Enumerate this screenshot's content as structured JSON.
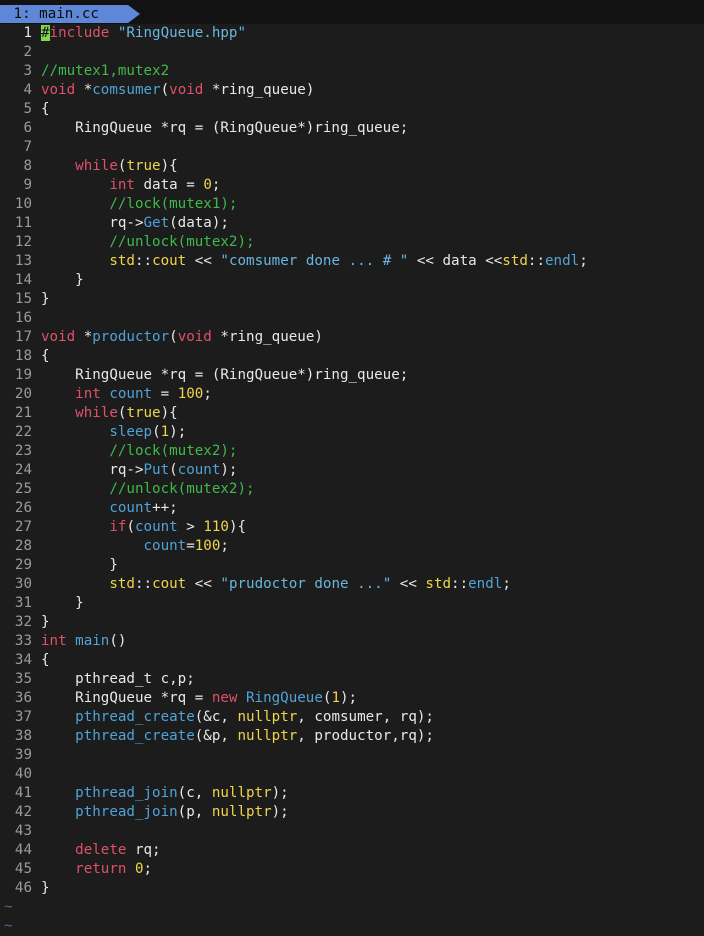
{
  "tabline": {
    "tab_label": " 1: main.cc"
  },
  "editor": {
    "lines": [
      {
        "n": "1",
        "segs": [
          [
            "cursor",
            "#"
          ],
          [
            "kw",
            "include"
          ],
          [
            "tx",
            " "
          ],
          [
            "st",
            "\"RingQueue.hpp\""
          ]
        ]
      },
      {
        "n": "2",
        "segs": []
      },
      {
        "n": "3",
        "segs": [
          [
            "cm",
            "//mutex1,mutex2"
          ]
        ]
      },
      {
        "n": "4",
        "segs": [
          [
            "kw",
            "void"
          ],
          [
            "tx",
            " *"
          ],
          [
            "fn",
            "comsumer"
          ],
          [
            "tx",
            "("
          ],
          [
            "kw",
            "void"
          ],
          [
            "tx",
            " *ring_queue)"
          ]
        ]
      },
      {
        "n": "5",
        "segs": [
          [
            "tx",
            "{"
          ]
        ]
      },
      {
        "n": "6",
        "segs": [
          [
            "tx",
            "    RingQueue *rq = (RingQueue*)ring_queue;"
          ]
        ]
      },
      {
        "n": "7",
        "segs": []
      },
      {
        "n": "8",
        "segs": [
          [
            "tx",
            "    "
          ],
          [
            "kw",
            "while"
          ],
          [
            "tx",
            "("
          ],
          [
            "bo",
            "true"
          ],
          [
            "tx",
            "){"
          ]
        ]
      },
      {
        "n": "9",
        "segs": [
          [
            "tx",
            "        "
          ],
          [
            "kw",
            "int"
          ],
          [
            "tx",
            " data = "
          ],
          [
            "nm",
            "0"
          ],
          [
            "tx",
            ";"
          ]
        ]
      },
      {
        "n": "10",
        "segs": [
          [
            "tx",
            "        "
          ],
          [
            "cm",
            "//lock(mutex1);"
          ]
        ]
      },
      {
        "n": "11",
        "segs": [
          [
            "tx",
            "        rq->"
          ],
          [
            "fn",
            "Get"
          ],
          [
            "tx",
            "(data);"
          ]
        ]
      },
      {
        "n": "12",
        "segs": [
          [
            "tx",
            "        "
          ],
          [
            "cm",
            "//unlock(mutex2);"
          ]
        ]
      },
      {
        "n": "13",
        "segs": [
          [
            "tx",
            "        "
          ],
          [
            "bo",
            "std"
          ],
          [
            "tx",
            "::"
          ],
          [
            "bo",
            "cout"
          ],
          [
            "tx",
            " << "
          ],
          [
            "st",
            "\"comsumer done ... # \""
          ],
          [
            "tx",
            " << data <<"
          ],
          [
            "bo",
            "std"
          ],
          [
            "tx",
            "::"
          ],
          [
            "fn",
            "endl"
          ],
          [
            "tx",
            ";"
          ]
        ]
      },
      {
        "n": "14",
        "segs": [
          [
            "tx",
            "    }"
          ]
        ]
      },
      {
        "n": "15",
        "segs": [
          [
            "tx",
            "}"
          ]
        ]
      },
      {
        "n": "16",
        "segs": []
      },
      {
        "n": "17",
        "segs": [
          [
            "kw",
            "void"
          ],
          [
            "tx",
            " *"
          ],
          [
            "fn",
            "productor"
          ],
          [
            "tx",
            "("
          ],
          [
            "kw",
            "void"
          ],
          [
            "tx",
            " *ring_queue)"
          ]
        ]
      },
      {
        "n": "18",
        "segs": [
          [
            "tx",
            "{"
          ]
        ]
      },
      {
        "n": "19",
        "segs": [
          [
            "tx",
            "    RingQueue *rq = (RingQueue*)ring_queue;"
          ]
        ]
      },
      {
        "n": "20",
        "segs": [
          [
            "tx",
            "    "
          ],
          [
            "kw",
            "int"
          ],
          [
            "tx",
            " "
          ],
          [
            "fn",
            "count"
          ],
          [
            "tx",
            " = "
          ],
          [
            "nm",
            "100"
          ],
          [
            "tx",
            ";"
          ]
        ]
      },
      {
        "n": "21",
        "segs": [
          [
            "tx",
            "    "
          ],
          [
            "kw",
            "while"
          ],
          [
            "tx",
            "("
          ],
          [
            "bo",
            "true"
          ],
          [
            "tx",
            "){"
          ]
        ]
      },
      {
        "n": "22",
        "segs": [
          [
            "tx",
            "        "
          ],
          [
            "fn",
            "sleep"
          ],
          [
            "tx",
            "("
          ],
          [
            "nm",
            "1"
          ],
          [
            "tx",
            ");"
          ]
        ]
      },
      {
        "n": "23",
        "segs": [
          [
            "tx",
            "        "
          ],
          [
            "cm",
            "//lock(mutex2);"
          ]
        ]
      },
      {
        "n": "24",
        "segs": [
          [
            "tx",
            "        rq->"
          ],
          [
            "fn",
            "Put"
          ],
          [
            "tx",
            "("
          ],
          [
            "fn",
            "count"
          ],
          [
            "tx",
            ");"
          ]
        ]
      },
      {
        "n": "25",
        "segs": [
          [
            "tx",
            "        "
          ],
          [
            "cm",
            "//unlock(mutex2);"
          ]
        ]
      },
      {
        "n": "26",
        "segs": [
          [
            "tx",
            "        "
          ],
          [
            "fn",
            "count"
          ],
          [
            "tx",
            "++;"
          ]
        ]
      },
      {
        "n": "27",
        "segs": [
          [
            "tx",
            "        "
          ],
          [
            "kw",
            "if"
          ],
          [
            "tx",
            "("
          ],
          [
            "fn",
            "count"
          ],
          [
            "tx",
            " > "
          ],
          [
            "nm",
            "110"
          ],
          [
            "tx",
            "){"
          ]
        ]
      },
      {
        "n": "28",
        "segs": [
          [
            "tx",
            "            "
          ],
          [
            "fn",
            "count"
          ],
          [
            "tx",
            "="
          ],
          [
            "nm",
            "100"
          ],
          [
            "tx",
            ";"
          ]
        ]
      },
      {
        "n": "29",
        "segs": [
          [
            "tx",
            "        }"
          ]
        ]
      },
      {
        "n": "30",
        "segs": [
          [
            "tx",
            "        "
          ],
          [
            "bo",
            "std"
          ],
          [
            "tx",
            "::"
          ],
          [
            "bo",
            "cout"
          ],
          [
            "tx",
            " << "
          ],
          [
            "st",
            "\"prudoctor done ...\""
          ],
          [
            "tx",
            " << "
          ],
          [
            "bo",
            "std"
          ],
          [
            "tx",
            "::"
          ],
          [
            "fn",
            "endl"
          ],
          [
            "tx",
            ";"
          ]
        ]
      },
      {
        "n": "31",
        "segs": [
          [
            "tx",
            "    }"
          ]
        ]
      },
      {
        "n": "32",
        "segs": [
          [
            "tx",
            "}"
          ]
        ]
      },
      {
        "n": "33",
        "segs": [
          [
            "kw",
            "int"
          ],
          [
            "tx",
            " "
          ],
          [
            "fn",
            "main"
          ],
          [
            "tx",
            "()"
          ]
        ]
      },
      {
        "n": "34",
        "segs": [
          [
            "tx",
            "{"
          ]
        ]
      },
      {
        "n": "35",
        "segs": [
          [
            "tx",
            "    pthread_t c,p;"
          ]
        ]
      },
      {
        "n": "36",
        "segs": [
          [
            "tx",
            "    RingQueue *rq = "
          ],
          [
            "kw",
            "new"
          ],
          [
            "tx",
            " "
          ],
          [
            "fn",
            "RingQueue"
          ],
          [
            "tx",
            "("
          ],
          [
            "nm",
            "1"
          ],
          [
            "tx",
            ");"
          ]
        ]
      },
      {
        "n": "37",
        "segs": [
          [
            "tx",
            "    "
          ],
          [
            "fn",
            "pthread_create"
          ],
          [
            "tx",
            "(&c, "
          ],
          [
            "bo",
            "nullptr"
          ],
          [
            "tx",
            ", comsumer, rq);"
          ]
        ]
      },
      {
        "n": "38",
        "segs": [
          [
            "tx",
            "    "
          ],
          [
            "fn",
            "pthread_create"
          ],
          [
            "tx",
            "(&p, "
          ],
          [
            "bo",
            "nullptr"
          ],
          [
            "tx",
            ", productor,rq);"
          ]
        ]
      },
      {
        "n": "39",
        "segs": []
      },
      {
        "n": "40",
        "segs": []
      },
      {
        "n": "41",
        "segs": [
          [
            "tx",
            "    "
          ],
          [
            "fn",
            "pthread_join"
          ],
          [
            "tx",
            "(c, "
          ],
          [
            "bo",
            "nullptr"
          ],
          [
            "tx",
            ");"
          ]
        ]
      },
      {
        "n": "42",
        "segs": [
          [
            "tx",
            "    "
          ],
          [
            "fn",
            "pthread_join"
          ],
          [
            "tx",
            "(p, "
          ],
          [
            "bo",
            "nullptr"
          ],
          [
            "tx",
            ");"
          ]
        ]
      },
      {
        "n": "43",
        "segs": []
      },
      {
        "n": "44",
        "segs": [
          [
            "tx",
            "    "
          ],
          [
            "kw",
            "delete"
          ],
          [
            "tx",
            " rq;"
          ]
        ]
      },
      {
        "n": "45",
        "segs": [
          [
            "tx",
            "    "
          ],
          [
            "kw",
            "return"
          ],
          [
            "tx",
            " "
          ],
          [
            "nm",
            "0"
          ],
          [
            "tx",
            ";"
          ]
        ]
      },
      {
        "n": "46",
        "segs": [
          [
            "tx",
            "}"
          ]
        ]
      }
    ],
    "empty_buffer_markers": [
      "~",
      "~"
    ]
  }
}
